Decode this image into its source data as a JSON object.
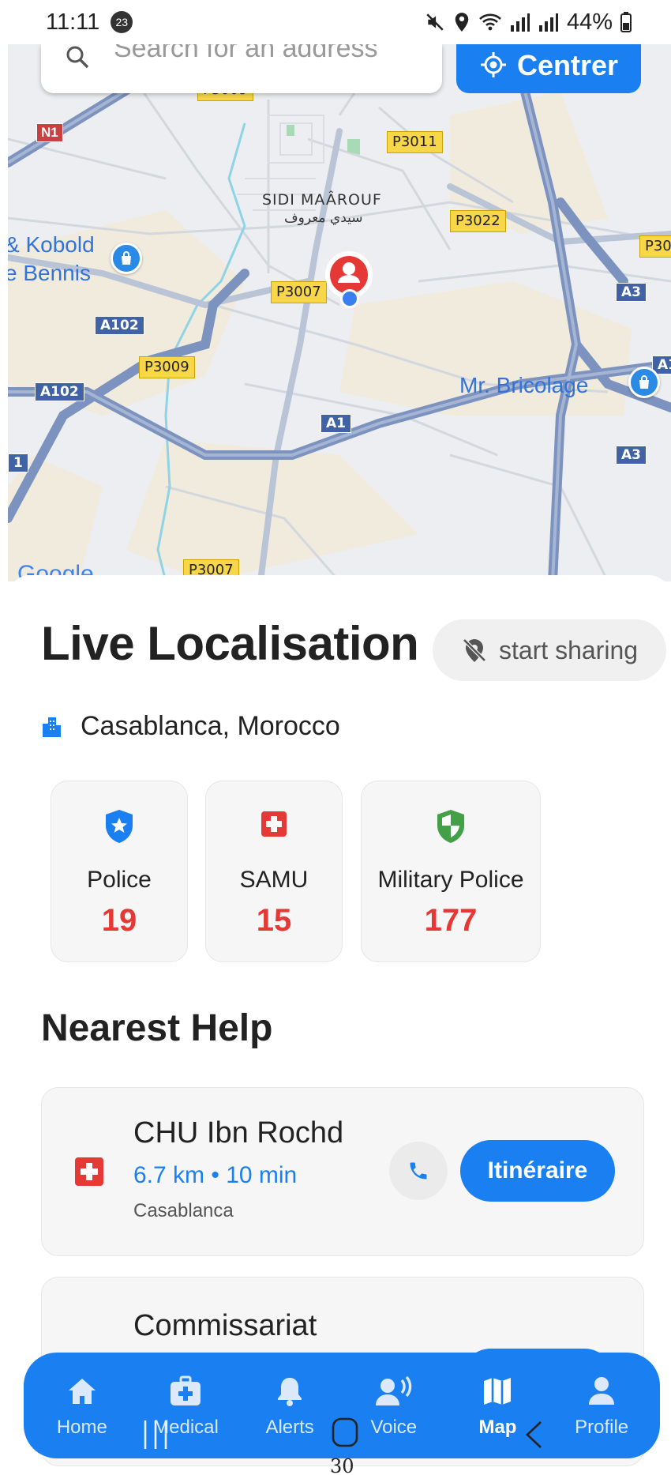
{
  "status_bar": {
    "time": "11:11",
    "notification_count": "23",
    "battery": "44%"
  },
  "map": {
    "search_placeholder": "Search for an address",
    "center_button": "Centrer",
    "place_name": "SIDI MAÂROUF",
    "place_name_arabic": "سيدي معروف",
    "poi_left": [
      "& Kobold",
      "e Bennis"
    ],
    "poi_right": "Mr. Bricolage",
    "road_labels": [
      "P3009",
      "P3011",
      "P3022",
      "P3007",
      "P3009",
      "P3007",
      "P30"
    ],
    "highway_labels": [
      "N1",
      "A102",
      "A102",
      "A1",
      "A3",
      "A3",
      "A1",
      "1"
    ],
    "attribution": "Google"
  },
  "sheet": {
    "title": "Live Localisation",
    "share_button": "start sharing",
    "city": "Casablanca, Morocco",
    "emergency_cards": [
      {
        "name": "Police",
        "number": "19",
        "icon": "shield-star-icon",
        "color": "#1a7ff0"
      },
      {
        "name": "SAMU",
        "number": "15",
        "icon": "medical-cross-icon",
        "color": "#e53935"
      },
      {
        "name": "Military Police",
        "number": "177",
        "icon": "shield-half-icon",
        "color": "#43a047"
      }
    ],
    "nearest_heading": "Nearest Help",
    "help_items": [
      {
        "name": "CHU Ibn Rochd",
        "distance": "6.7 km • 10 min",
        "city": "Casablanca",
        "route_button": "Itinéraire"
      },
      {
        "name": "Commissariat"
      }
    ]
  },
  "bottom_nav": {
    "items": [
      {
        "label": "Home",
        "icon": "home-icon"
      },
      {
        "label": "Medical",
        "icon": "medical-kit-icon"
      },
      {
        "label": "Alerts",
        "icon": "bell-icon"
      },
      {
        "label": "Voice",
        "icon": "voice-icon"
      },
      {
        "label": "Map",
        "icon": "map-icon",
        "active": true
      },
      {
        "label": "Profile",
        "icon": "person-icon"
      }
    ]
  },
  "page_number": "30",
  "colors": {
    "primary": "#1a7ff0",
    "danger": "#e53935",
    "success": "#43a047"
  }
}
